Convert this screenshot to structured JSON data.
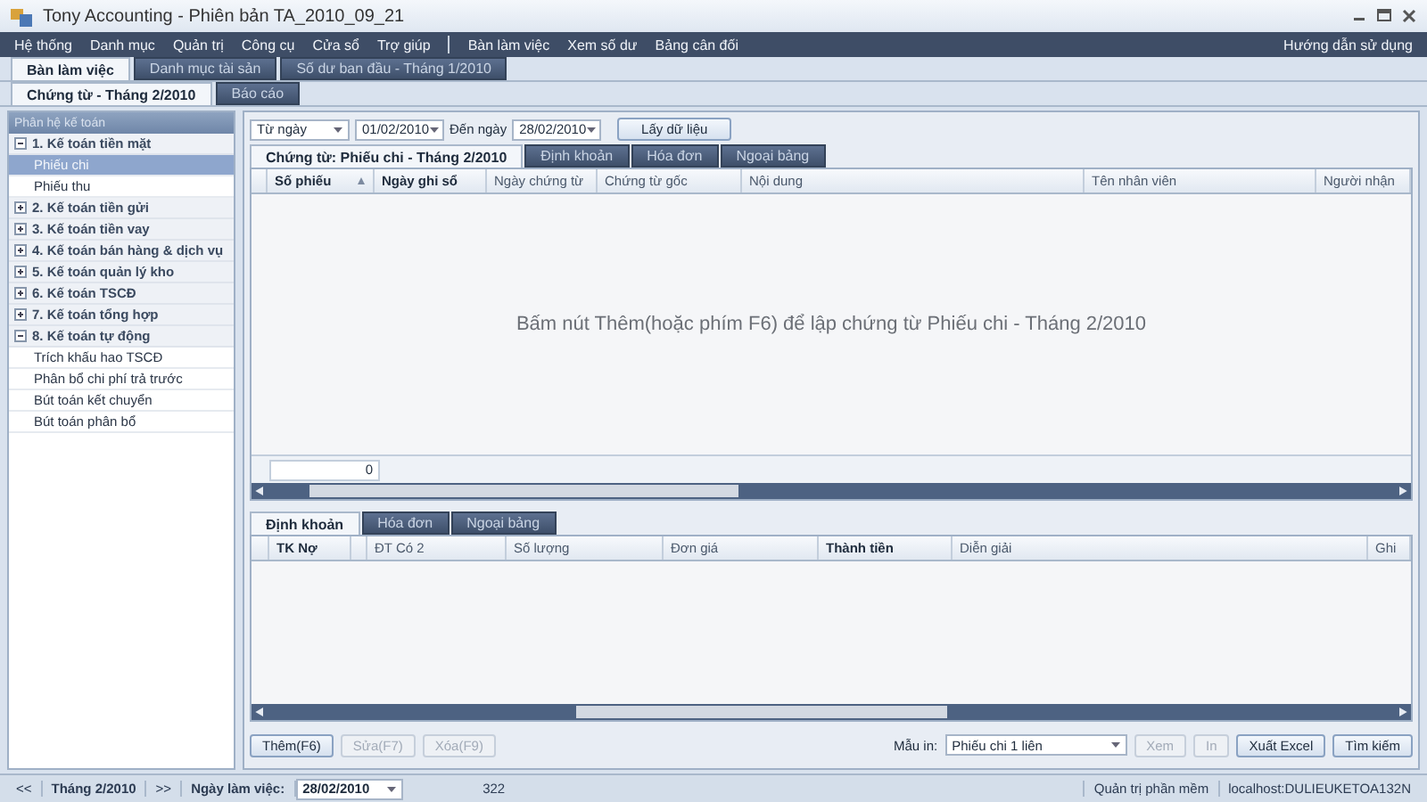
{
  "window": {
    "title": "Tony Accounting - Phiên bản TA_2010_09_21"
  },
  "menu": {
    "left_items": [
      "Hệ thống",
      "Danh mục",
      "Quản trị",
      "Công cụ",
      "Cửa sổ",
      "Trợ giúp"
    ],
    "right_items": [
      "Bàn làm việc",
      "Xem số dư",
      "Bảng cân đối"
    ],
    "help": "Hướng dẫn sử dụng"
  },
  "workspace_tabs": [
    {
      "label": "Bàn làm việc",
      "selected": true
    },
    {
      "label": "Danh mục tài sản",
      "selected": false
    },
    {
      "label": "Số dư ban đầu - Tháng 1/2010",
      "selected": false
    }
  ],
  "page_tabs": [
    {
      "label": "Chứng từ - Tháng 2/2010",
      "selected": true
    },
    {
      "label": "Báo cáo",
      "selected": false
    }
  ],
  "sidebar": {
    "title": "Phân hệ kế toán",
    "groups": [
      {
        "label": "1. Kế toán tiền mặt",
        "expanded": true,
        "children": [
          {
            "label": "Phiếu chi",
            "selected": true
          },
          {
            "label": "Phiếu thu",
            "selected": false
          }
        ]
      },
      {
        "label": "2. Kế toán tiền gửi",
        "expanded": false
      },
      {
        "label": "3. Kế toán tiền vay",
        "expanded": false
      },
      {
        "label": "4. Kế toán bán hàng & dịch vụ",
        "expanded": false
      },
      {
        "label": "5. Kế toán quản lý kho",
        "expanded": false
      },
      {
        "label": "6. Kế toán TSCĐ",
        "expanded": false
      },
      {
        "label": "7. Kế toán tổng hợp",
        "expanded": false
      },
      {
        "label": "8. Kế toán tự động",
        "expanded": true,
        "children": [
          {
            "label": "Trích khấu hao TSCĐ",
            "selected": false
          },
          {
            "label": "Phân bổ chi phí trả trước",
            "selected": false
          },
          {
            "label": "Bút toán kết chuyển",
            "selected": false
          },
          {
            "label": "Bút toán phân bổ",
            "selected": false
          }
        ]
      }
    ]
  },
  "filter": {
    "mode": "Từ ngày",
    "from_date": "01/02/2010",
    "to_label": "Đến ngày",
    "to_date": "28/02/2010",
    "button": "Lấy dữ liệu"
  },
  "document_tabs": [
    {
      "label": "Chứng từ: Phiếu chi - Tháng 2/2010",
      "selected": true
    },
    {
      "label": "Định khoản",
      "selected": false
    },
    {
      "label": "Hóa đơn",
      "selected": false
    },
    {
      "label": "Ngoại bảng",
      "selected": false
    }
  ],
  "voucher_table": {
    "columns": [
      {
        "label": "Số phiếu",
        "bold": true,
        "sorted": true
      },
      {
        "label": "Ngày ghi sổ",
        "bold": true,
        "sorted": false
      },
      {
        "label": "Ngày chứng từ",
        "bold": false,
        "sorted": false
      },
      {
        "label": "Chứng từ gốc",
        "bold": false,
        "sorted": false
      },
      {
        "label": "Nội dung",
        "bold": false,
        "sorted": false
      },
      {
        "label": "Tên nhân viên",
        "bold": false,
        "sorted": false
      },
      {
        "label": "Người nhận",
        "bold": false,
        "sorted": false
      }
    ],
    "empty_message": "Bấm nút Thêm(hoặc phím F6) để lập chứng từ Phiếu chi - Tháng 2/2010",
    "total": "0"
  },
  "detail_tabs": [
    {
      "label": "Định khoản",
      "selected": true
    },
    {
      "label": "Hóa đơn",
      "selected": false
    },
    {
      "label": "Ngoại bảng",
      "selected": false
    }
  ],
  "detail_table": {
    "columns": [
      {
        "label": "TK Nợ",
        "bold": true
      },
      {
        "label": "ĐT Có 2",
        "bold": false
      },
      {
        "label": "Số lượng",
        "bold": false
      },
      {
        "label": "Đơn giá",
        "bold": false
      },
      {
        "label": "Thành tiền",
        "bold": true
      },
      {
        "label": "Diễn giải",
        "bold": false
      },
      {
        "label": "Ghi",
        "bold": false
      }
    ]
  },
  "actions": {
    "edit_buttons": [
      {
        "label": "Thêm(F6)",
        "disabled": false
      },
      {
        "label": "Sửa(F7)",
        "disabled": true
      },
      {
        "label": "Xóa(F9)",
        "disabled": true
      }
    ],
    "print_label": "Mẫu in:",
    "print_template": "Phiếu chi 1 liên",
    "output_buttons": [
      {
        "label": "Xem",
        "disabled": true
      },
      {
        "label": "In",
        "disabled": true
      },
      {
        "label": "Xuất Excel",
        "disabled": false
      },
      {
        "label": "Tìm kiếm",
        "disabled": false
      }
    ]
  },
  "status_bar": {
    "prev": "<<",
    "period": "Tháng 2/2010",
    "next": ">>",
    "work_date_label": "Ngày làm việc:",
    "work_date": "28/02/2010",
    "count": "322",
    "user": "Quản trị phần mềm",
    "server": "localhost:DULIEUKETOA132N"
  }
}
